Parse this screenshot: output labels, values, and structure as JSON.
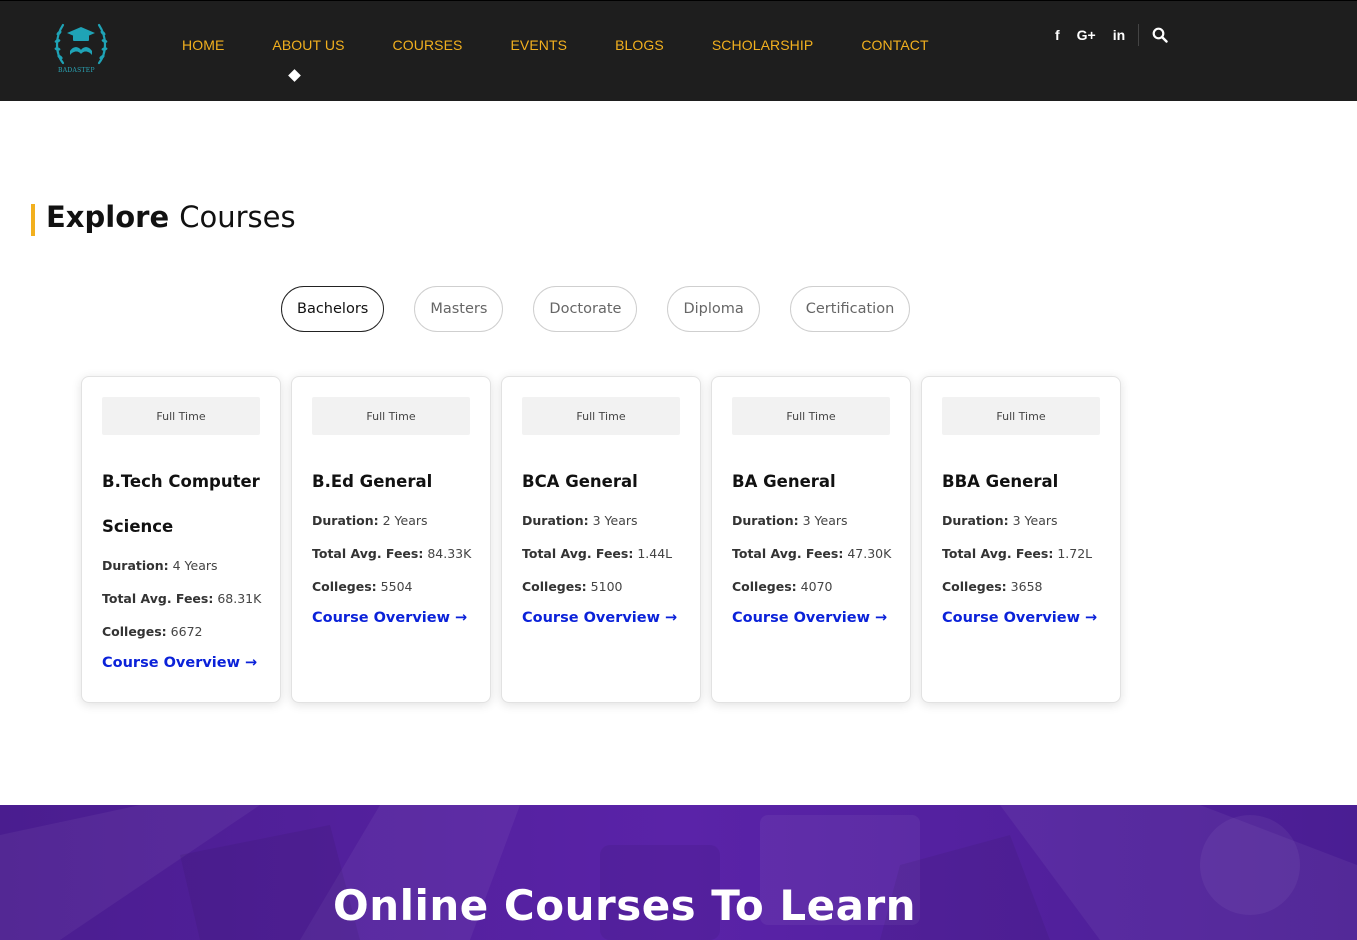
{
  "header": {
    "logo_text": "BADASTEP",
    "nav": [
      {
        "label": "HOME"
      },
      {
        "label": "ABOUT US"
      },
      {
        "label": "COURSES"
      },
      {
        "label": "EVENTS"
      },
      {
        "label": "BLOGS"
      },
      {
        "label": "SCHOLARSHIP"
      },
      {
        "label": "CONTACT"
      }
    ],
    "active_nav": "ABOUT US",
    "social": [
      {
        "icon": "facebook-icon",
        "glyph": "f"
      },
      {
        "icon": "google-plus-icon",
        "glyph": "G+"
      },
      {
        "icon": "linkedin-icon",
        "glyph": "in"
      }
    ],
    "accent_color": "#f2b01e"
  },
  "explore": {
    "title_bold": "Explore",
    "title_light": "Courses"
  },
  "tabs": [
    {
      "label": "Bachelors",
      "active": true
    },
    {
      "label": "Masters",
      "active": false
    },
    {
      "label": "Doctorate",
      "active": false
    },
    {
      "label": "Diploma",
      "active": false
    },
    {
      "label": "Certification",
      "active": false
    }
  ],
  "card_labels": {
    "duration": "Duration:",
    "fees": "Total Avg. Fees:",
    "colleges": "Colleges:",
    "link": "Course Overview →"
  },
  "cards": [
    {
      "badge": "Full Time",
      "title_line1": "B.Tech Computer",
      "title_line2": "Science",
      "duration": "4 Years",
      "fees": "68.31K",
      "colleges": "6672"
    },
    {
      "badge": "Full Time",
      "title_line1": "B.Ed General",
      "title_line2": "",
      "duration": "2 Years",
      "fees": "84.33K",
      "colleges": "5504"
    },
    {
      "badge": "Full Time",
      "title_line1": "BCA General",
      "title_line2": "",
      "duration": "3 Years",
      "fees": "1.44L",
      "colleges": "5100"
    },
    {
      "badge": "Full Time",
      "title_line1": "BA General",
      "title_line2": "",
      "duration": "3 Years",
      "fees": "47.30K",
      "colleges": "4070"
    },
    {
      "badge": "Full Time",
      "title_line1": "BBA General",
      "title_line2": "",
      "duration": "3 Years",
      "fees": "1.72L",
      "colleges": "3658"
    }
  ],
  "banner": {
    "title": "Online Courses To Learn"
  }
}
